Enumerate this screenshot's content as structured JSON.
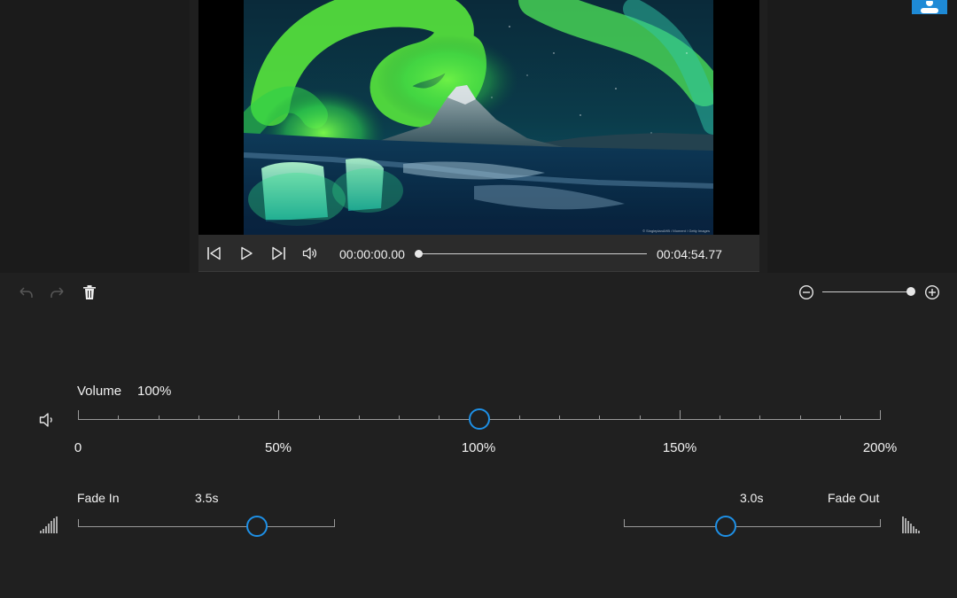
{
  "player": {
    "current_time": "00:00:00.00",
    "total_time": "00:04:54.77",
    "progress": 0,
    "photo_credit": "© SingleplanAHB / Moment / Getty Images"
  },
  "volume": {
    "label": "Volume",
    "value_text": "100%",
    "value_percent": 100,
    "range": [
      0,
      200
    ],
    "tick_labels": [
      "0",
      "50%",
      "100%",
      "150%",
      "200%"
    ]
  },
  "fade_in": {
    "label": "Fade In",
    "value_text": "3.5s",
    "value": 3.5
  },
  "fade_out": {
    "label": "Fade Out",
    "value_text": "3.0s",
    "value": 3.0
  },
  "zoom": {
    "level_fraction": 1.0
  },
  "icons": {
    "previous": "skip-previous-icon",
    "play": "play-icon",
    "next": "skip-next-icon",
    "speaker": "speaker-icon",
    "undo": "undo-icon",
    "redo": "redo-icon",
    "delete": "trash-icon",
    "zoom_out": "zoom-out-icon",
    "zoom_in": "zoom-in-icon",
    "fade_in": "fade-in-icon",
    "fade_out": "fade-out-icon",
    "profile": "person-icon"
  },
  "colors": {
    "accent": "#1e90e6",
    "background": "#202020"
  }
}
